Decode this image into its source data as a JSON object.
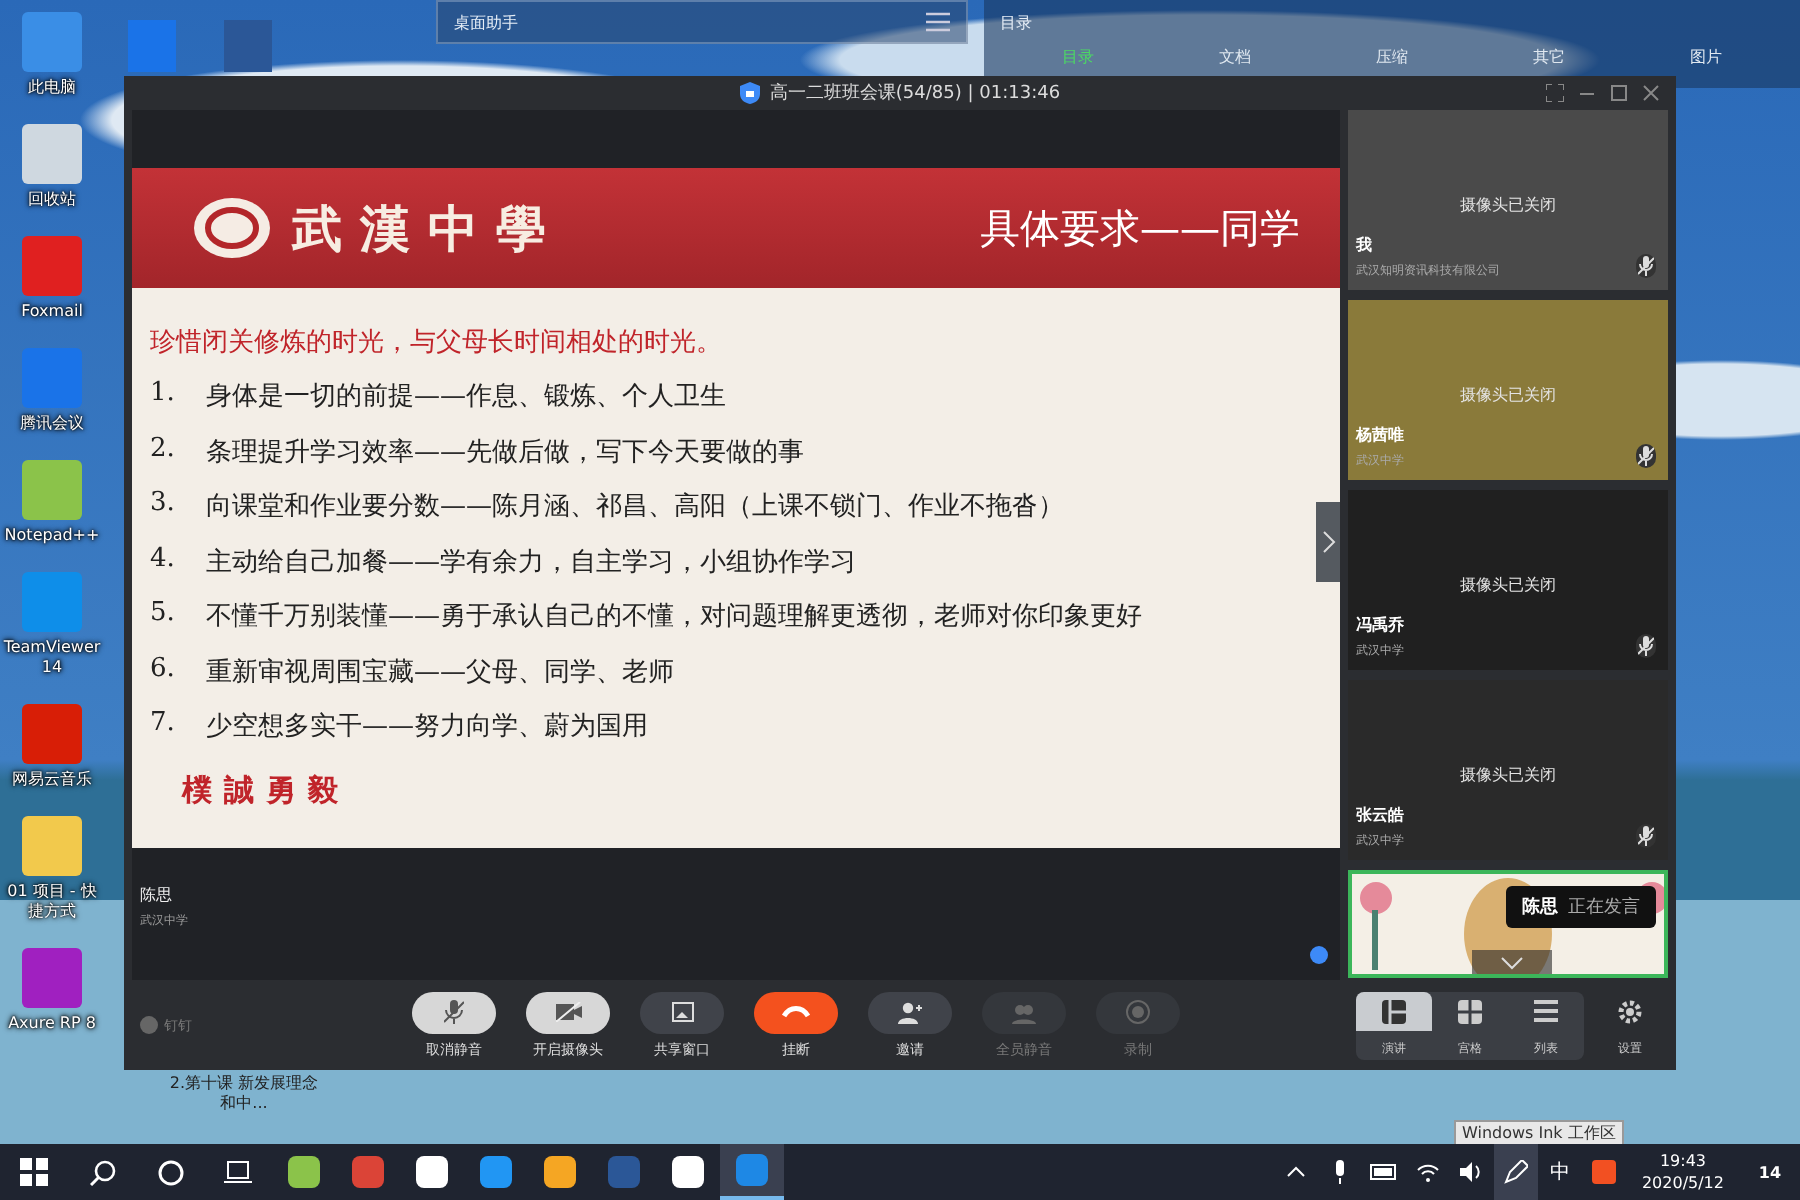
{
  "desktop_icons": [
    {
      "label": "此电脑"
    },
    {
      "label": "回收站"
    },
    {
      "label": "Foxmail"
    },
    {
      "label": "腾讯会议"
    },
    {
      "label": "Notepad++"
    },
    {
      "label": "TeamViewer 14"
    },
    {
      "label": "网易云音乐"
    },
    {
      "label": "01 项目 - 快捷方式"
    },
    {
      "label": "Axure RP 8"
    }
  ],
  "desktop_files": [
    {
      "label": "2.第十课 新发展理念和中..."
    }
  ],
  "desk_helper": {
    "title": "桌面助手"
  },
  "catalog": {
    "title": "目录",
    "tabs": [
      {
        "label": "目录",
        "selected": true
      },
      {
        "label": "文档",
        "selected": false
      },
      {
        "label": "压缩",
        "selected": false
      },
      {
        "label": "其它",
        "selected": false
      },
      {
        "label": "图片",
        "selected": false
      }
    ]
  },
  "meeting": {
    "title": "高一二班班会课(54/85) | 01:13:46",
    "slide": {
      "school": "武漢中學",
      "heading": "具体要求——同学",
      "lead": "珍惜闭关修炼的时光，与父母长时间相处的时光。",
      "items": [
        {
          "num": "1.",
          "text": "身体是一切的前提——作息、锻炼、个人卫生"
        },
        {
          "num": "2.",
          "text": "条理提升学习效率——先做后做，写下今天要做的事"
        },
        {
          "num": "3.",
          "text": "向课堂和作业要分数——陈月涵、祁昌、高阳（上课不锁门、作业不拖沓）"
        },
        {
          "num": "4.",
          "text": "主动给自己加餐——学有余力，自主学习，小组协作学习"
        },
        {
          "num": "5.",
          "text": "不懂千万别装懂——勇于承认自己的不懂，对问题理解更透彻，老师对你印象更好"
        },
        {
          "num": "6.",
          "text": "重新审视周围宝藏——父母、同学、老师"
        },
        {
          "num": "7.",
          "text": "少空想多实干——努力向学、蔚为国用"
        }
      ],
      "motto": "樸誠勇毅"
    },
    "presenter": {
      "name": "陈思",
      "org": "武汉中学"
    },
    "brand": "钉钉",
    "controls": [
      {
        "label": "取消静音",
        "kind": "mic",
        "disabled": false
      },
      {
        "label": "开启摄像头",
        "kind": "camera",
        "disabled": false
      },
      {
        "label": "共享窗口",
        "kind": "share",
        "disabled": false
      },
      {
        "label": "挂断",
        "kind": "hangup",
        "disabled": false
      },
      {
        "label": "邀请",
        "kind": "invite",
        "disabled": false
      },
      {
        "label": "全员静音",
        "kind": "muteall",
        "disabled": true
      },
      {
        "label": "录制",
        "kind": "record",
        "disabled": true
      }
    ],
    "view_modes": [
      {
        "label": "演讲",
        "selected": true
      },
      {
        "label": "宫格",
        "selected": false
      },
      {
        "label": "列表",
        "selected": false
      }
    ],
    "settings": "设置",
    "participants": [
      {
        "name": "我",
        "org": "武汉知明资讯科技有限公司",
        "status": "摄像头已关闭"
      },
      {
        "name": "杨茜唯",
        "org": "武汉中学",
        "status": "摄像头已关闭"
      },
      {
        "name": "冯禹乔",
        "org": "武汉中学",
        "status": "摄像头已关闭"
      },
      {
        "name": "张云皓",
        "org": "武汉中学",
        "status": "摄像头已关闭"
      }
    ],
    "speaker": {
      "name": "陈思",
      "status": "正在发言"
    }
  },
  "taskbar": {
    "tooltip": "Windows Ink 工作区",
    "ime": "中",
    "time": "19:43",
    "date": "2020/5/12",
    "notifications": "14"
  }
}
